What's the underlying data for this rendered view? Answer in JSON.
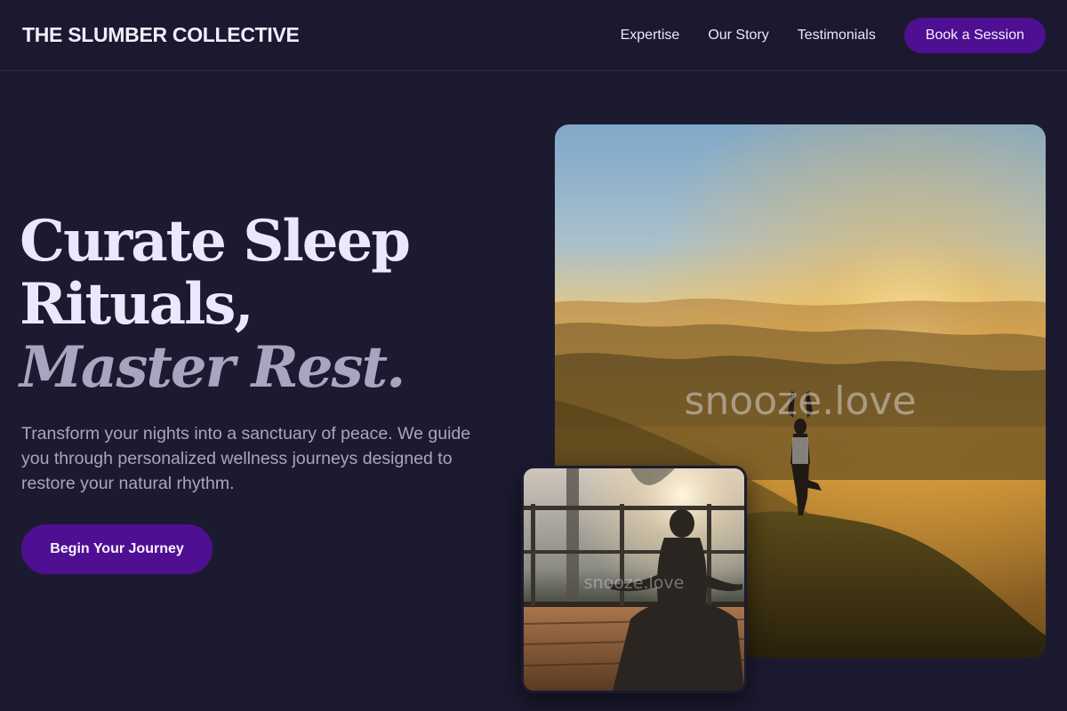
{
  "header": {
    "brand": "THE SLUMBER COLLECTIVE",
    "nav": [
      {
        "label": "Expertise"
      },
      {
        "label": "Our Story"
      },
      {
        "label": "Testimonials"
      }
    ],
    "cta_label": "Book a Session"
  },
  "hero": {
    "headline_line1": "Curate Sleep",
    "headline_line2": "Rituals,",
    "headline_accent": "Master Rest.",
    "description": "Transform your nights into a sanctuary of peace. We guide you through personalized wellness journeys designed to restore your natural rhythm.",
    "cta_label": "Begin Your Journey"
  },
  "images": {
    "main_watermark": "snooze.love",
    "inset_watermark": "snooze.love"
  },
  "colors": {
    "background": "#1c1a30",
    "accent": "#4f0f92",
    "heading": "#ece8fb",
    "muted": "#a9a5bf"
  }
}
